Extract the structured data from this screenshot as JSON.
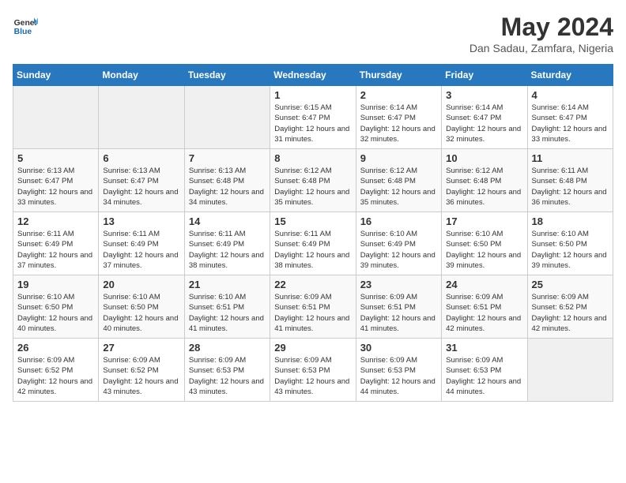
{
  "header": {
    "logo_line1": "General",
    "logo_line2": "Blue",
    "title": "May 2024",
    "subtitle": "Dan Sadau, Zamfara, Nigeria"
  },
  "columns": [
    "Sunday",
    "Monday",
    "Tuesday",
    "Wednesday",
    "Thursday",
    "Friday",
    "Saturday"
  ],
  "weeks": [
    [
      {
        "day": "",
        "info": ""
      },
      {
        "day": "",
        "info": ""
      },
      {
        "day": "",
        "info": ""
      },
      {
        "day": "1",
        "info": "Sunrise: 6:15 AM\nSunset: 6:47 PM\nDaylight: 12 hours and 31 minutes."
      },
      {
        "day": "2",
        "info": "Sunrise: 6:14 AM\nSunset: 6:47 PM\nDaylight: 12 hours and 32 minutes."
      },
      {
        "day": "3",
        "info": "Sunrise: 6:14 AM\nSunset: 6:47 PM\nDaylight: 12 hours and 32 minutes."
      },
      {
        "day": "4",
        "info": "Sunrise: 6:14 AM\nSunset: 6:47 PM\nDaylight: 12 hours and 33 minutes."
      }
    ],
    [
      {
        "day": "5",
        "info": "Sunrise: 6:13 AM\nSunset: 6:47 PM\nDaylight: 12 hours and 33 minutes."
      },
      {
        "day": "6",
        "info": "Sunrise: 6:13 AM\nSunset: 6:47 PM\nDaylight: 12 hours and 34 minutes."
      },
      {
        "day": "7",
        "info": "Sunrise: 6:13 AM\nSunset: 6:48 PM\nDaylight: 12 hours and 34 minutes."
      },
      {
        "day": "8",
        "info": "Sunrise: 6:12 AM\nSunset: 6:48 PM\nDaylight: 12 hours and 35 minutes."
      },
      {
        "day": "9",
        "info": "Sunrise: 6:12 AM\nSunset: 6:48 PM\nDaylight: 12 hours and 35 minutes."
      },
      {
        "day": "10",
        "info": "Sunrise: 6:12 AM\nSunset: 6:48 PM\nDaylight: 12 hours and 36 minutes."
      },
      {
        "day": "11",
        "info": "Sunrise: 6:11 AM\nSunset: 6:48 PM\nDaylight: 12 hours and 36 minutes."
      }
    ],
    [
      {
        "day": "12",
        "info": "Sunrise: 6:11 AM\nSunset: 6:49 PM\nDaylight: 12 hours and 37 minutes."
      },
      {
        "day": "13",
        "info": "Sunrise: 6:11 AM\nSunset: 6:49 PM\nDaylight: 12 hours and 37 minutes."
      },
      {
        "day": "14",
        "info": "Sunrise: 6:11 AM\nSunset: 6:49 PM\nDaylight: 12 hours and 38 minutes."
      },
      {
        "day": "15",
        "info": "Sunrise: 6:11 AM\nSunset: 6:49 PM\nDaylight: 12 hours and 38 minutes."
      },
      {
        "day": "16",
        "info": "Sunrise: 6:10 AM\nSunset: 6:49 PM\nDaylight: 12 hours and 39 minutes."
      },
      {
        "day": "17",
        "info": "Sunrise: 6:10 AM\nSunset: 6:50 PM\nDaylight: 12 hours and 39 minutes."
      },
      {
        "day": "18",
        "info": "Sunrise: 6:10 AM\nSunset: 6:50 PM\nDaylight: 12 hours and 39 minutes."
      }
    ],
    [
      {
        "day": "19",
        "info": "Sunrise: 6:10 AM\nSunset: 6:50 PM\nDaylight: 12 hours and 40 minutes."
      },
      {
        "day": "20",
        "info": "Sunrise: 6:10 AM\nSunset: 6:50 PM\nDaylight: 12 hours and 40 minutes."
      },
      {
        "day": "21",
        "info": "Sunrise: 6:10 AM\nSunset: 6:51 PM\nDaylight: 12 hours and 41 minutes."
      },
      {
        "day": "22",
        "info": "Sunrise: 6:09 AM\nSunset: 6:51 PM\nDaylight: 12 hours and 41 minutes."
      },
      {
        "day": "23",
        "info": "Sunrise: 6:09 AM\nSunset: 6:51 PM\nDaylight: 12 hours and 41 minutes."
      },
      {
        "day": "24",
        "info": "Sunrise: 6:09 AM\nSunset: 6:51 PM\nDaylight: 12 hours and 42 minutes."
      },
      {
        "day": "25",
        "info": "Sunrise: 6:09 AM\nSunset: 6:52 PM\nDaylight: 12 hours and 42 minutes."
      }
    ],
    [
      {
        "day": "26",
        "info": "Sunrise: 6:09 AM\nSunset: 6:52 PM\nDaylight: 12 hours and 42 minutes."
      },
      {
        "day": "27",
        "info": "Sunrise: 6:09 AM\nSunset: 6:52 PM\nDaylight: 12 hours and 43 minutes."
      },
      {
        "day": "28",
        "info": "Sunrise: 6:09 AM\nSunset: 6:53 PM\nDaylight: 12 hours and 43 minutes."
      },
      {
        "day": "29",
        "info": "Sunrise: 6:09 AM\nSunset: 6:53 PM\nDaylight: 12 hours and 43 minutes."
      },
      {
        "day": "30",
        "info": "Sunrise: 6:09 AM\nSunset: 6:53 PM\nDaylight: 12 hours and 44 minutes."
      },
      {
        "day": "31",
        "info": "Sunrise: 6:09 AM\nSunset: 6:53 PM\nDaylight: 12 hours and 44 minutes."
      },
      {
        "day": "",
        "info": ""
      }
    ]
  ]
}
